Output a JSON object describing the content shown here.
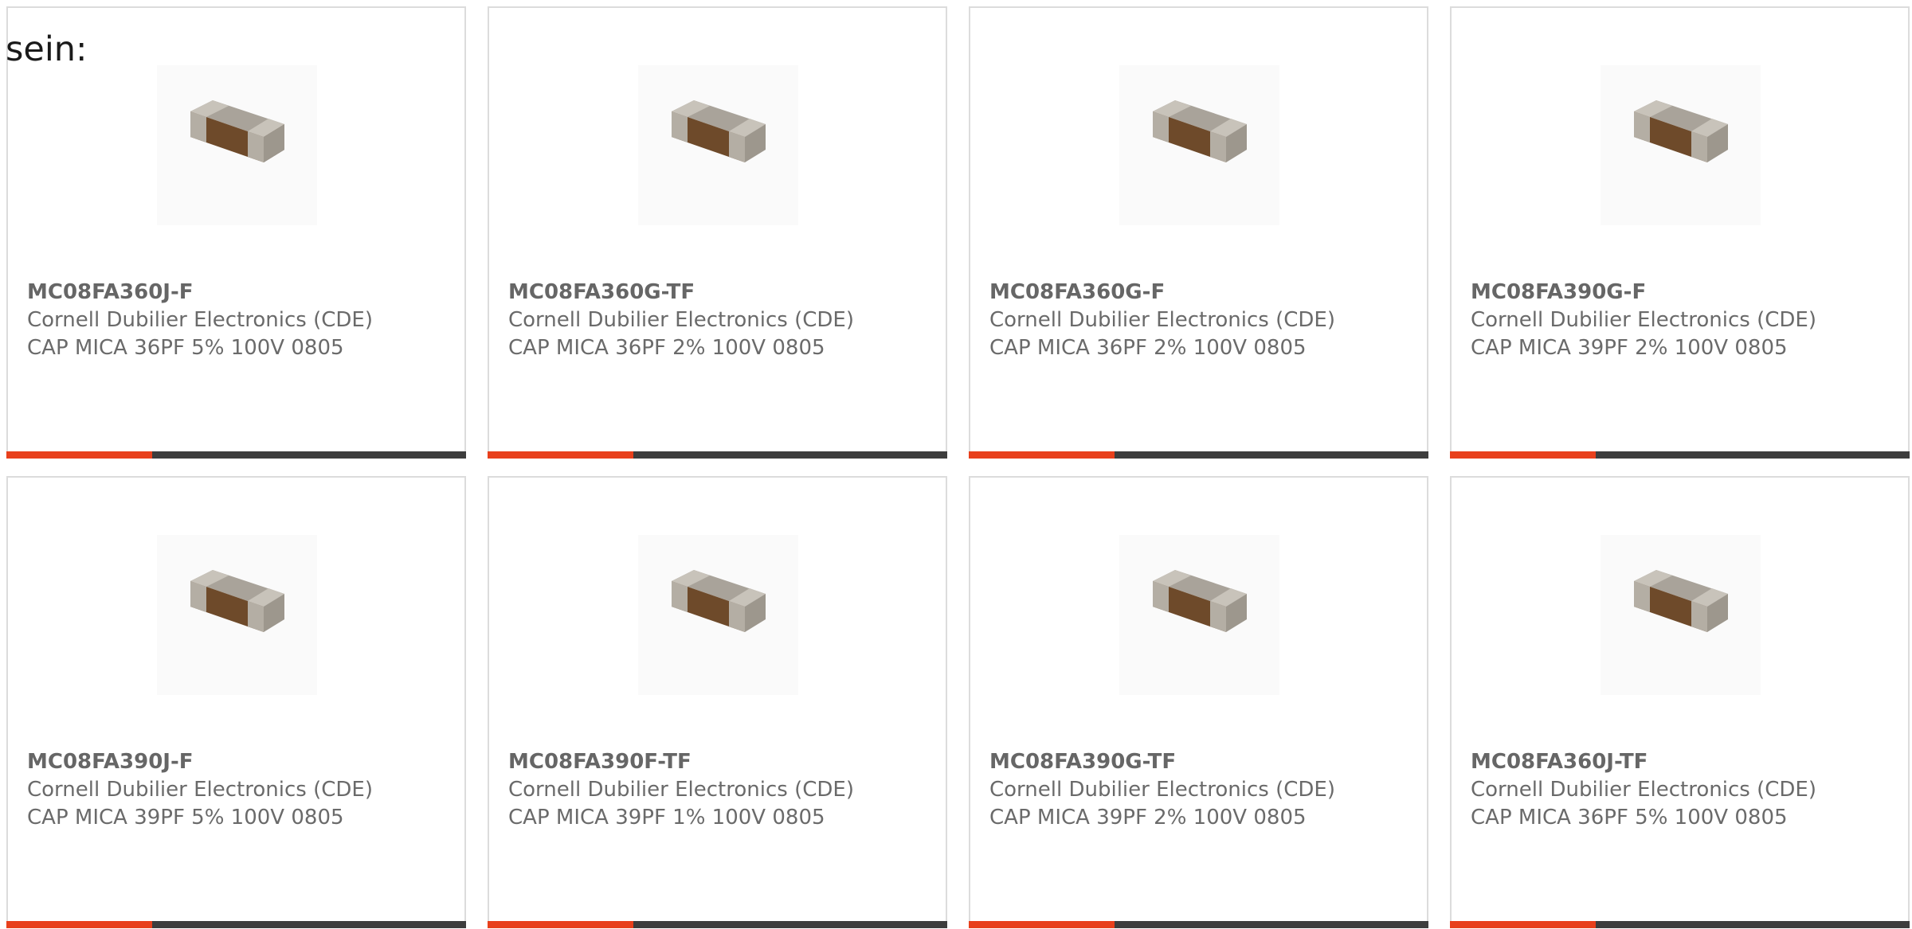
{
  "intro_text": "sein:",
  "colors": {
    "accent": "#e8401c",
    "bar": "#3d3d3d",
    "border": "#dcdcdc",
    "text": "#6a6a6a"
  },
  "products": [
    {
      "part_number": "MC08FA360J-F",
      "manufacturer": "Cornell Dubilier Electronics (CDE)",
      "description": "CAP MICA 36PF 5% 100V 0805",
      "image_icon": "smd-capacitor-image"
    },
    {
      "part_number": "MC08FA360G-TF",
      "manufacturer": "Cornell Dubilier Electronics (CDE)",
      "description": "CAP MICA 36PF 2% 100V 0805",
      "image_icon": "smd-capacitor-image"
    },
    {
      "part_number": "MC08FA360G-F",
      "manufacturer": "Cornell Dubilier Electronics (CDE)",
      "description": "CAP MICA 36PF 2% 100V 0805",
      "image_icon": "smd-capacitor-image"
    },
    {
      "part_number": "MC08FA390G-F",
      "manufacturer": "Cornell Dubilier Electronics (CDE)",
      "description": "CAP MICA 39PF 2% 100V 0805",
      "image_icon": "smd-capacitor-image"
    },
    {
      "part_number": "MC08FA390J-F",
      "manufacturer": "Cornell Dubilier Electronics (CDE)",
      "description": "CAP MICA 39PF 5% 100V 0805",
      "image_icon": "smd-capacitor-image"
    },
    {
      "part_number": "MC08FA390F-TF",
      "manufacturer": "Cornell Dubilier Electronics (CDE)",
      "description": "CAP MICA 39PF 1% 100V 0805",
      "image_icon": "smd-capacitor-image"
    },
    {
      "part_number": "MC08FA390G-TF",
      "manufacturer": "Cornell Dubilier Electronics (CDE)",
      "description": "CAP MICA 39PF 2% 100V 0805",
      "image_icon": "smd-capacitor-image"
    },
    {
      "part_number": "MC08FA360J-TF",
      "manufacturer": "Cornell Dubilier Electronics (CDE)",
      "description": "CAP MICA 36PF 5% 100V 0805",
      "image_icon": "smd-capacitor-image"
    }
  ]
}
